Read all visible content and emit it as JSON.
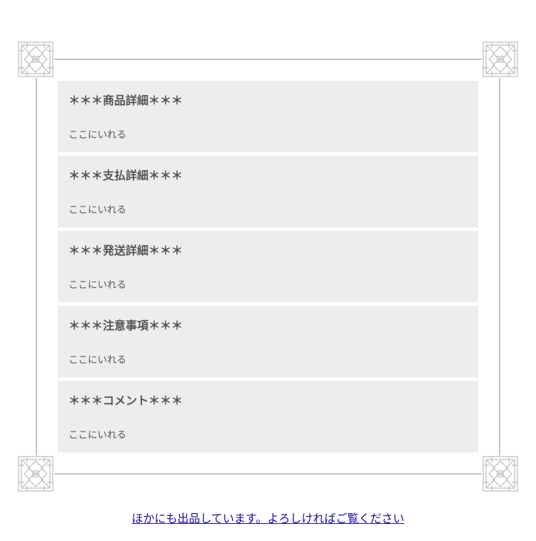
{
  "frame": {
    "line_color": "#c4c4c4",
    "ornament_icon": "ornament-corner-icon"
  },
  "sections": [
    {
      "title": "＊＊＊商品詳細＊＊＊",
      "body": "ここにいれる"
    },
    {
      "title": "＊＊＊支払詳細＊＊＊",
      "body": "ここにいれる"
    },
    {
      "title": "＊＊＊発送詳細＊＊＊",
      "body": "ここにいれる"
    },
    {
      "title": "＊＊＊注意事項＊＊＊",
      "body": "ここにいれる"
    },
    {
      "title": "＊＊＊コメント＊＊＊",
      "body": "ここにいれる"
    }
  ],
  "section_background": "#ededed",
  "text_color": "#555555",
  "footer": {
    "link_label": "ほかにも出品しています。よろしければご覧ください",
    "link_color": "#1a0dab"
  }
}
